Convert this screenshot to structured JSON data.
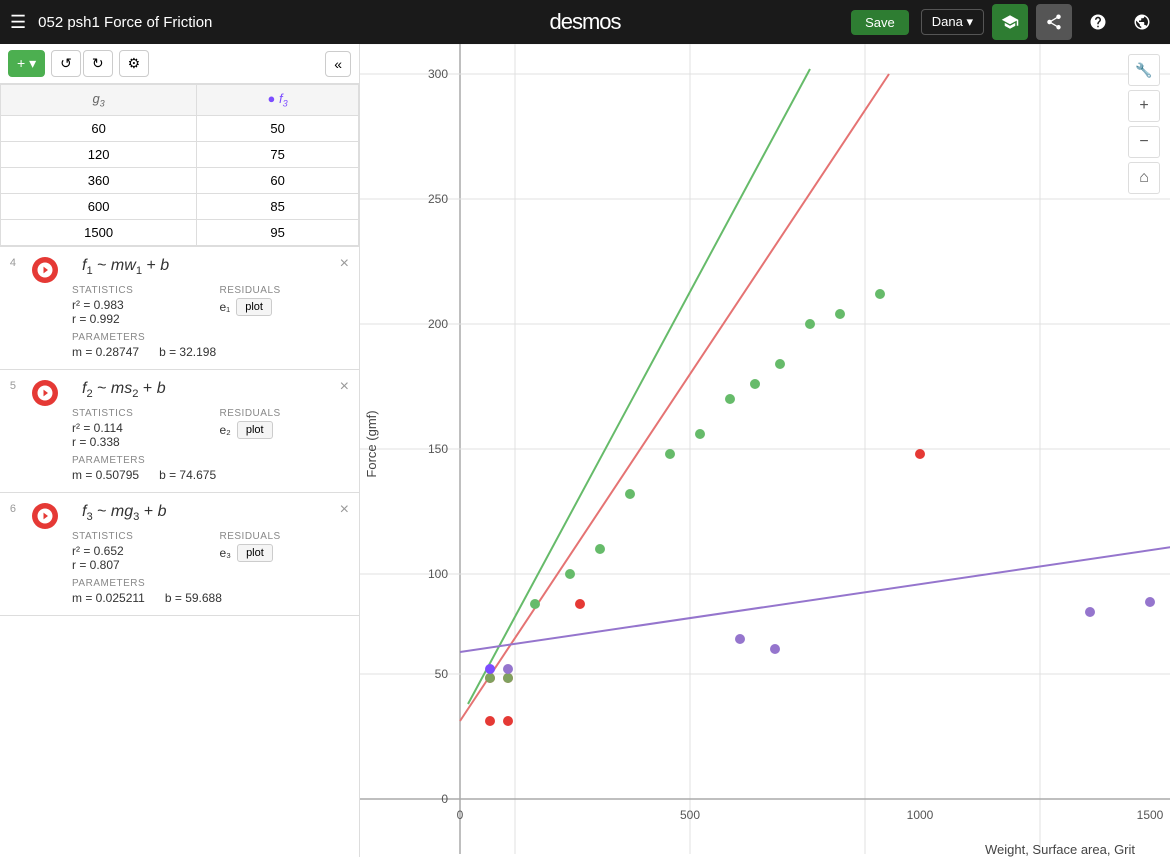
{
  "topbar": {
    "hamburger": "☰",
    "title": "052 psh1 Force of Friction",
    "save_label": "Save",
    "logo": "desmos",
    "user": "Dana",
    "user_caret": "▾"
  },
  "toolbar": {
    "add_label": "+ ▾",
    "undo_label": "↺",
    "redo_label": "↻",
    "settings_label": "⚙",
    "collapse_label": "«"
  },
  "table": {
    "col1_header": "g₃",
    "col2_header": "f₃",
    "rows": [
      {
        "g": "60",
        "f": "50"
      },
      {
        "g": "120",
        "f": "75"
      },
      {
        "g": "360",
        "f": "60"
      },
      {
        "g": "600",
        "f": "85"
      },
      {
        "g": "1500",
        "f": "95"
      }
    ]
  },
  "expressions": [
    {
      "number": "4",
      "formula": "f₁ ~ mw₁ + b",
      "stats": {
        "r2": "r² = 0.983",
        "r": "r = 0.992"
      },
      "residuals_label": "e₁",
      "parameters": {
        "m": "m = 0.28747",
        "b": "b = 32.198"
      }
    },
    {
      "number": "5",
      "formula": "f₂ ~ ms₂ + b",
      "stats": {
        "r2": "r² = 0.114",
        "r": "r = 0.338"
      },
      "residuals_label": "e₂",
      "parameters": {
        "m": "m = 0.50795",
        "b": "b = 74.675"
      }
    },
    {
      "number": "6",
      "formula": "f₃ ~ mg₃ + b",
      "stats": {
        "r2": "r² = 0.652",
        "r": "r = 0.807"
      },
      "residuals_label": "e₃",
      "parameters": {
        "m": "m = 0.025211",
        "b": "b = 59.688"
      }
    }
  ],
  "graph": {
    "y_label": "Force (gmf)",
    "x_label": "Weight, Surface area, Grit",
    "y_ticks": [
      "300",
      "250",
      "200",
      "150",
      "100",
      "50",
      "0"
    ],
    "x_ticks": [
      "0",
      "500",
      "1000",
      "1500"
    ],
    "zoom_in": "+",
    "zoom_out": "−",
    "home": "⌂",
    "wrench": "🔧"
  },
  "labels": {
    "statistics": "STATISTICS",
    "residuals": "RESIDUALS",
    "parameters": "PARAMETERS",
    "plot": "plot"
  }
}
